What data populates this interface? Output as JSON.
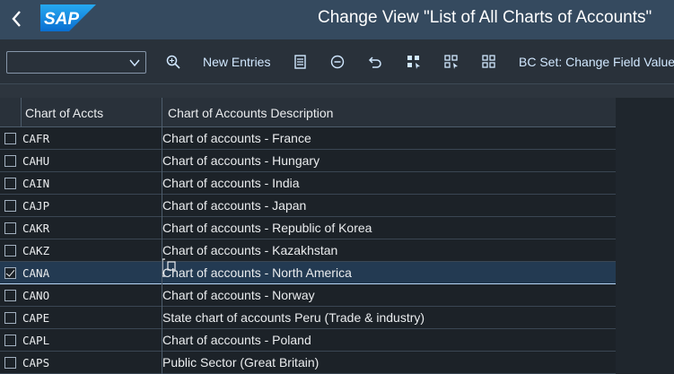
{
  "header": {
    "title": "Change View \"List of All Charts of Accounts\"",
    "logo_text": "SAP"
  },
  "toolbar": {
    "command_field_value": "",
    "new_entries_label": "New Entries",
    "bc_set_label": "BC Set: Change Field Values"
  },
  "table": {
    "columns": [
      "Chart of Accts",
      "Chart of Accounts Description"
    ],
    "rows": [
      {
        "code": "CAFR",
        "description": "Chart of accounts - France",
        "selected": false
      },
      {
        "code": "CAHU",
        "description": "Chart of accounts - Hungary",
        "selected": false
      },
      {
        "code": "CAIN",
        "description": "Chart of accounts - India",
        "selected": false
      },
      {
        "code": "CAJP",
        "description": "Chart of accounts - Japan",
        "selected": false
      },
      {
        "code": "CAKR",
        "description": "Chart of accounts - Republic of Korea",
        "selected": false
      },
      {
        "code": "CAKZ",
        "description": "Chart of accounts - Kazakhstan",
        "selected": false
      },
      {
        "code": "CANA",
        "description": "Chart of accounts - North America",
        "selected": true
      },
      {
        "code": "CANO",
        "description": "Chart of accounts - Norway",
        "selected": false
      },
      {
        "code": "CAPE",
        "description": "State chart of accounts Peru (Trade & industry)",
        "selected": false
      },
      {
        "code": "CAPL",
        "description": "Chart of accounts - Poland",
        "selected": false
      },
      {
        "code": "CAPS",
        "description": "Public Sector (Great Britain)",
        "selected": false
      }
    ]
  },
  "colors": {
    "header_bg": "#354a5f",
    "toolbar_bg": "#29313a",
    "accent": "#d1e8ff",
    "logo_blue": "#1a8fe3"
  }
}
